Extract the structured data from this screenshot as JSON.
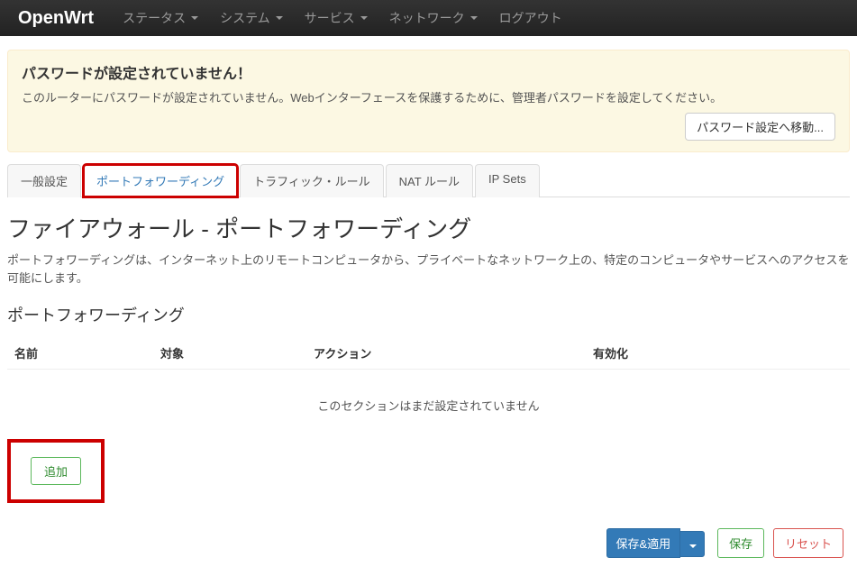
{
  "navbar": {
    "brand": "OpenWrt",
    "items": [
      "ステータス",
      "システム",
      "サービス",
      "ネットワーク",
      "ログアウト"
    ],
    "has_caret": [
      true,
      true,
      true,
      true,
      false
    ]
  },
  "alert": {
    "title": "パスワードが設定されていません！",
    "body": "このルーターにパスワードが設定されていません。Webインターフェースを保護するために、管理者パスワードを設定してください。",
    "button": "パスワード設定へ移動..."
  },
  "tabs": {
    "items": [
      "一般設定",
      "ポートフォワーディング",
      "トラフィック・ルール",
      "NAT ルール",
      "IP Sets"
    ],
    "active_index": 1
  },
  "page": {
    "heading": "ファイアウォール - ポートフォワーディング",
    "description": "ポートフォワーディングは、インターネット上のリモートコンピュータから、プライベートなネットワーク上の、特定のコンピュータやサービスへのアクセスを可能にします。",
    "section_title": "ポートフォワーディング"
  },
  "table": {
    "columns": {
      "name": "名前",
      "target": "対象",
      "action": "アクション",
      "enable": "有効化"
    },
    "empty": "このセクションはまだ設定されていません"
  },
  "buttons": {
    "add": "追加",
    "save_apply": "保存&適用",
    "save": "保存",
    "reset": "リセット"
  }
}
